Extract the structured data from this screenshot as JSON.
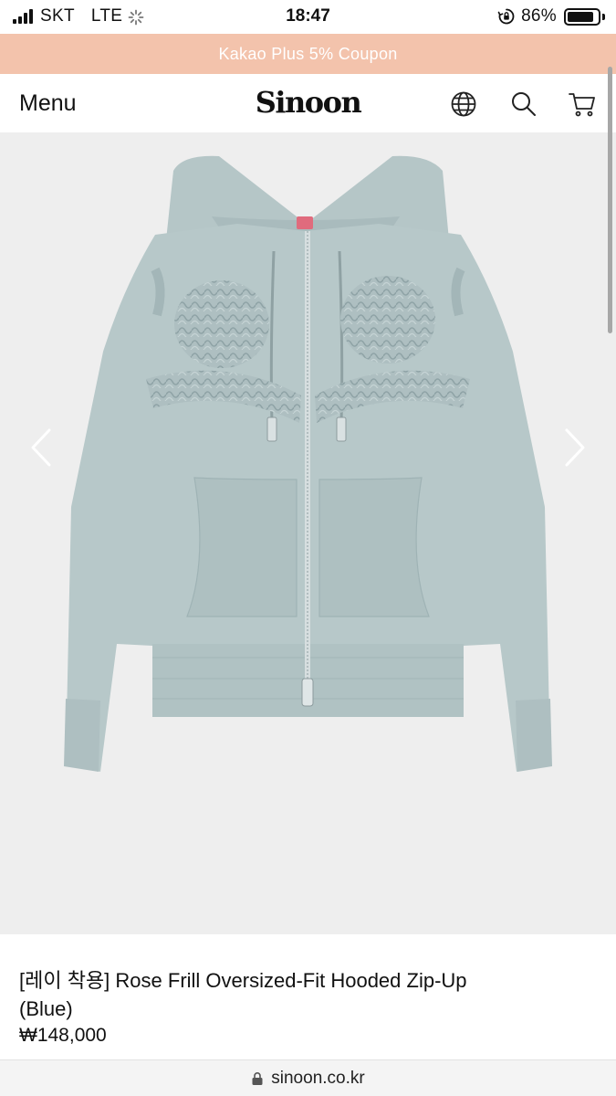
{
  "status_bar": {
    "carrier": "SKT",
    "network": "LTE",
    "time": "18:47",
    "battery_percent_text": "86%",
    "battery_level": 0.86
  },
  "banner": {
    "coupon_text": "Kakao Plus 5% Coupon",
    "background_color": "#f3c3ac"
  },
  "header": {
    "menu_label": "Menu",
    "logo_text": "Sinoon",
    "icons": [
      "globe-icon",
      "search-icon",
      "cart-icon"
    ]
  },
  "gallery": {
    "prev_icon": "chevron-left-icon",
    "next_icon": "chevron-right-icon",
    "background_color": "#eeeeee",
    "product_color": "#b7c8c9"
  },
  "product": {
    "name_line1": "[레이 착용] Rose Frill Oversized-Fit Hooded Zip-Up",
    "name_line2": "(Blue)",
    "price": "₩148,000"
  },
  "url_bar": {
    "url": "sinoon.co.kr"
  }
}
